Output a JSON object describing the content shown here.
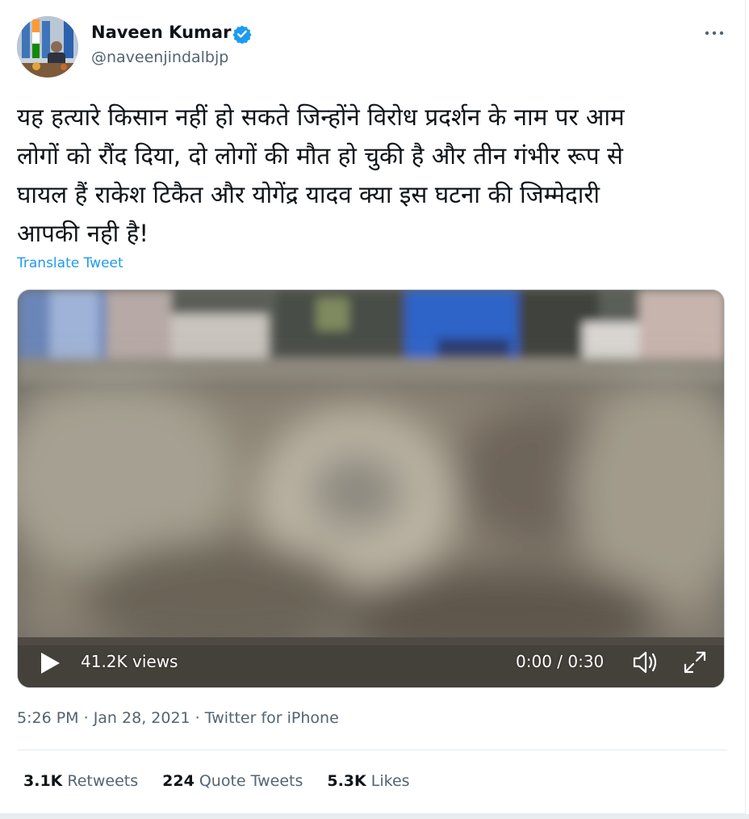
{
  "author": {
    "name": "Naveen Kumar",
    "handle": "@naveenjindalbjp",
    "verified_icon": "verified-badge-icon"
  },
  "more_icon": "more-options-icon",
  "tweet": {
    "text": "यह हत्यारे किसान नहीं हो सकते जिन्होंने विरोध प्रदर्शन के नाम पर आम\nलोगों को रौंद दिया, दो लोगों की मौत हो चुकी है और तीन गंभीर रूप से\nघायल हैं राकेश टिकैत और योगेंद्र यादव क्या इस घटना की जिम्मेदारी\nआपकी नही है!",
    "translate_label": "Translate Tweet"
  },
  "video": {
    "views": "41.2K views",
    "time": "0:00 / 0:30",
    "play_icon": "play-icon",
    "volume_icon": "volume-icon",
    "fullscreen_icon": "fullscreen-icon"
  },
  "meta": {
    "time": "5:26 PM",
    "date": "Jan 28, 2021",
    "source": "Twitter for iPhone",
    "separator": " · "
  },
  "stats": {
    "retweets_count": "3.1K",
    "retweets_label": "Retweets",
    "quotes_count": "224",
    "quotes_label": "Quote Tweets",
    "likes_count": "5.3K",
    "likes_label": "Likes"
  },
  "colors": {
    "link": "#1d9bf0",
    "secondary_text": "#536471",
    "verified": "#1d9bf0"
  }
}
